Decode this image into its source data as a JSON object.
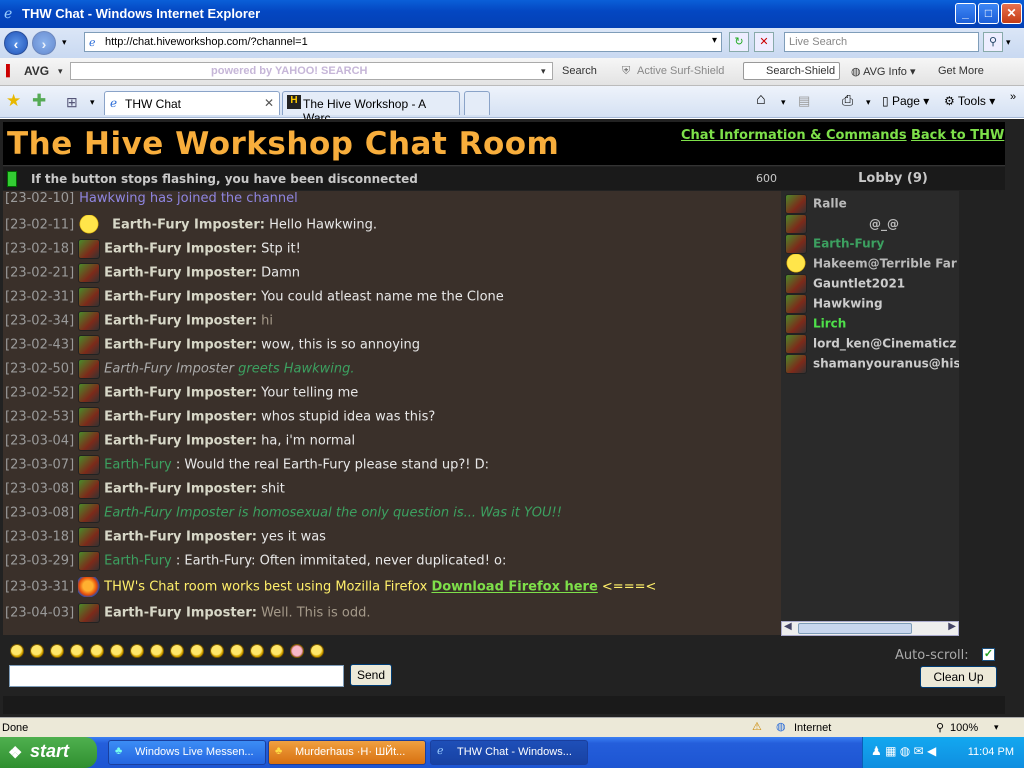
{
  "window": {
    "title": "THW Chat - Windows Internet Explorer",
    "minimize": "_",
    "maximize": "□",
    "close": "✕"
  },
  "addressbar": {
    "url": "http://chat.hiveworkshop.com/?channel=1",
    "livesearch_placeholder": "Live Search"
  },
  "toolbar_avg": {
    "avg_label": "AVG",
    "yahoo_text": "powered by YAHOO! SEARCH",
    "search": "Search",
    "active_surf": "Active  Surf-Shield",
    "search_shield": "Search-Shield",
    "avg_info": "AVG Info",
    "get_more": "Get More"
  },
  "tabs": [
    {
      "label": "THW Chat",
      "active": true
    },
    {
      "label": "The Hive Workshop - A Warc...",
      "active": false
    }
  ],
  "tabbar_right": {
    "page": "Page",
    "tools": "Tools"
  },
  "page": {
    "title": "The Hive Workshop Chat Room",
    "link_info": "Chat Information & Commands",
    "link_back": "Back to THW",
    "status": "If the button stops flashing, you have been disconnected",
    "counter": "600",
    "lobby_title": "Lobby (9)"
  },
  "messages": [
    {
      "ts": "[23-02-10]",
      "kind": "system",
      "text": "Hawkwing has joined the channel"
    },
    {
      "ts": "[23-02-11]",
      "kind": "chat",
      "avatar": "smile",
      "user": "Earth-Fury Imposter:",
      "text": "Hello Hawkwing."
    },
    {
      "ts": "[23-02-18]",
      "kind": "chat",
      "avatar": "orc",
      "user": "Earth-Fury Imposter:",
      "text": "Stp it!"
    },
    {
      "ts": "[23-02-21]",
      "kind": "chat",
      "avatar": "orc",
      "user": "Earth-Fury Imposter:",
      "text": "Damn"
    },
    {
      "ts": "[23-02-31]",
      "kind": "chat",
      "avatar": "orc",
      "user": "Earth-Fury Imposter:",
      "text": "You could atleast name me the Clone"
    },
    {
      "ts": "[23-02-34]",
      "kind": "chat",
      "avatar": "orc",
      "user": "Earth-Fury Imposter:",
      "text": "hi",
      "dim": true
    },
    {
      "ts": "[23-02-43]",
      "kind": "chat",
      "avatar": "orc",
      "user": "Earth-Fury Imposter:",
      "text": "wow, this is so annoying"
    },
    {
      "ts": "[23-02-50]",
      "kind": "emote",
      "avatar": "orc",
      "user": "Earth-Fury Imposter",
      "text": " greets Hawkwing."
    },
    {
      "ts": "[23-02-52]",
      "kind": "chat",
      "avatar": "orc",
      "user": "Earth-Fury Imposter:",
      "text": "Your telling me"
    },
    {
      "ts": "[23-02-53]",
      "kind": "chat",
      "avatar": "orc",
      "user": "Earth-Fury Imposter:",
      "text": "whos stupid idea was this?"
    },
    {
      "ts": "[23-03-04]",
      "kind": "chat",
      "avatar": "orc",
      "user": "Earth-Fury Imposter:",
      "text": "ha, i'm normal"
    },
    {
      "ts": "[23-03-07]",
      "kind": "greenchat",
      "avatar": "orc",
      "user": "Earth-Fury",
      "text": ": Would the real Earth-Fury please stand up?! D:"
    },
    {
      "ts": "[23-03-08]",
      "kind": "chat",
      "avatar": "orc",
      "user": "Earth-Fury Imposter:",
      "text": "shit"
    },
    {
      "ts": "[23-03-08]",
      "kind": "emote2",
      "avatar": "orc",
      "user": "",
      "text": "Earth-Fury Imposter is homosexual the only question is... Was it YOU!!"
    },
    {
      "ts": "[23-03-18]",
      "kind": "chat",
      "avatar": "orc",
      "user": "Earth-Fury Imposter:",
      "text": "yes it was"
    },
    {
      "ts": "[23-03-29]",
      "kind": "greenchat",
      "avatar": "orc",
      "user": "Earth-Fury",
      "text": ": Earth-Fury: Often immitated, never duplicated! o:"
    },
    {
      "ts": "[23-03-31]",
      "kind": "firefox",
      "avatar": "ff",
      "user": "",
      "text": "THW's Chat room works best using Mozilla Firefox ",
      "link": "Download Firefox here",
      "tail": " <===<"
    },
    {
      "ts": "[23-04-03]",
      "kind": "chat",
      "avatar": "orc",
      "user": "Earth-Fury Imposter:",
      "text": "Well. This is odd.",
      "dim": true
    }
  ],
  "lobby": [
    {
      "name": "Ralle",
      "color": "#bbbbbb"
    },
    {
      "name": "@_@",
      "color": "#bbbbbb"
    },
    {
      "name": "Earth-Fury",
      "color": "#3ca060"
    },
    {
      "name": "Hakeem@Terrible Far",
      "color": "#bbbbbb"
    },
    {
      "name": "Gauntlet2021",
      "color": "#cccccc"
    },
    {
      "name": "Hawkwing",
      "color": "#cccccc"
    },
    {
      "name": "Lirch",
      "color": "#4ee04a"
    },
    {
      "name": "lord_ken@Cinematicz",
      "color": "#cccccc"
    },
    {
      "name": "shamanyouranus@his",
      "color": "#cccccc"
    }
  ],
  "input": {
    "send": "Send",
    "autoscroll": "Auto-scroll:",
    "cleanup": "Clean Up"
  },
  "iestatus": {
    "done": "Done",
    "zone": "Internet",
    "zoom": "100%"
  },
  "taskbar": {
    "start": "start",
    "tasks": [
      "Windows Live Messen...",
      "Murderhaus ·H· ШЙt...",
      "THW Chat - Windows..."
    ],
    "clock": "11:04 PM"
  }
}
